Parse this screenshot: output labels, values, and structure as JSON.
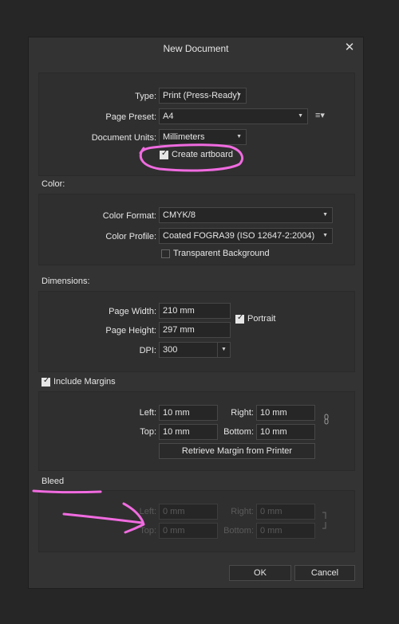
{
  "dialog": {
    "title": "New Document",
    "close_icon": "close-icon"
  },
  "general": {
    "type_label": "Type:",
    "type_value": "Print (Press-Ready)",
    "preset_label": "Page Preset:",
    "preset_value": "A4",
    "units_label": "Document Units:",
    "units_value": "Millimeters",
    "artboard_label": "Create artboard",
    "artboard_checked": true
  },
  "color": {
    "section": "Color:",
    "format_label": "Color Format:",
    "format_value": "CMYK/8",
    "profile_label": "Color Profile:",
    "profile_value": "Coated FOGRA39 (ISO 12647-2:2004)",
    "transparent_label": "Transparent Background",
    "transparent_checked": false
  },
  "dimensions": {
    "section": "Dimensions:",
    "width_label": "Page Width:",
    "width_value": "210 mm",
    "height_label": "Page Height:",
    "height_value": "297 mm",
    "dpi_label": "DPI:",
    "dpi_value": "300",
    "portrait_label": "Portrait",
    "portrait_checked": true
  },
  "margins": {
    "include_label": "Include Margins",
    "include_checked": true,
    "left_label": "Left:",
    "left_value": "10 mm",
    "right_label": "Right:",
    "right_value": "10 mm",
    "top_label": "Top:",
    "top_value": "10 mm",
    "bottom_label": "Bottom:",
    "bottom_value": "10 mm",
    "retrieve_label": "Retrieve Margin from Printer"
  },
  "bleed": {
    "section": "Bleed",
    "left_label": "Left:",
    "left_value": "0 mm",
    "right_label": "Right:",
    "right_value": "0 mm",
    "top_label": "Top:",
    "top_value": "0 mm",
    "bottom_label": "Bottom:",
    "bottom_value": "0 mm"
  },
  "footer": {
    "ok_label": "OK",
    "cancel_label": "Cancel"
  },
  "colors": {
    "annotation": "#f06be0",
    "dialog_bg": "#333333",
    "panel_bg": "#2f2f2f"
  }
}
